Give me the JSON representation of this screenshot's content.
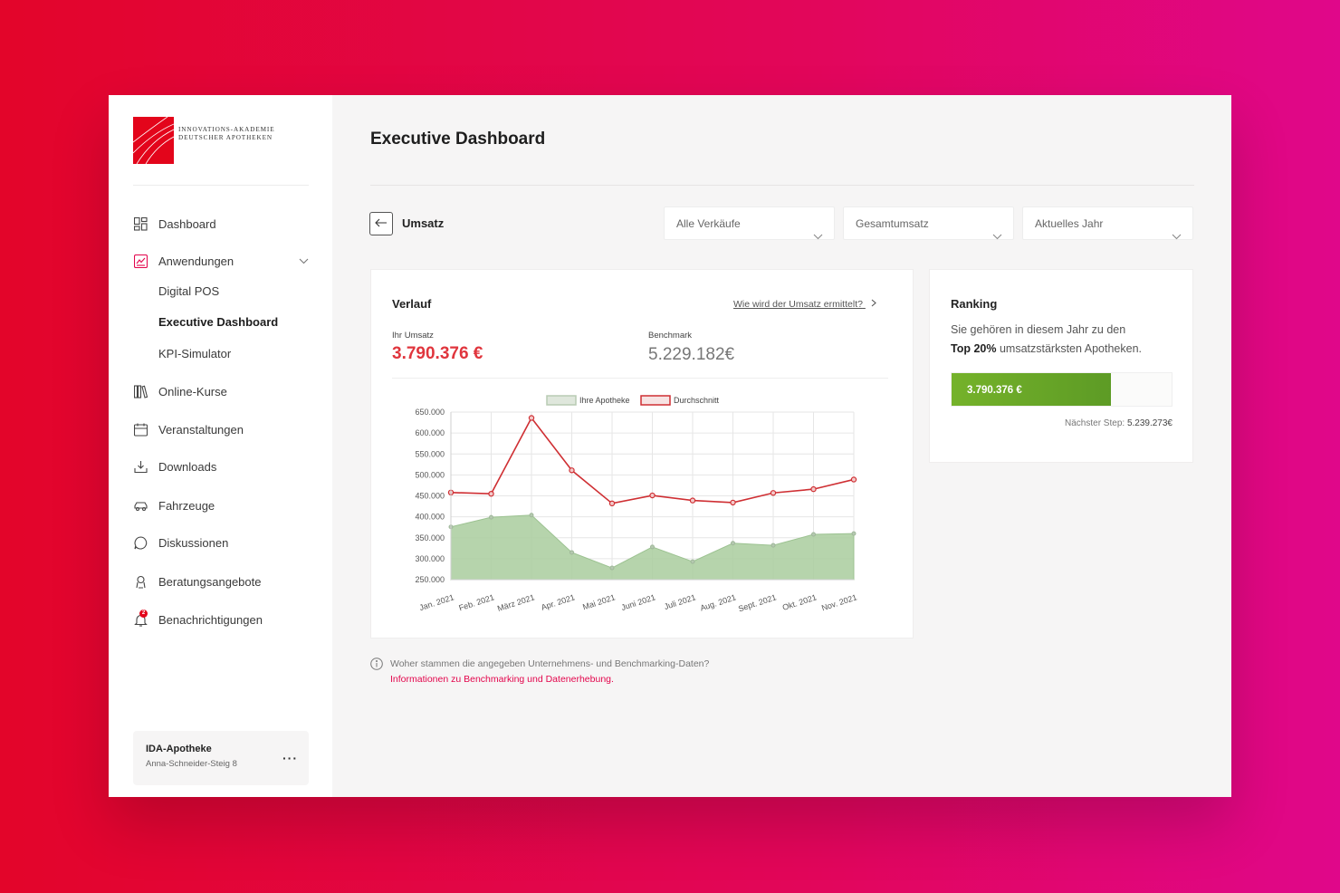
{
  "logo": {
    "line1": "INNOVATIONS-AKADEMIE",
    "line2": "DEUTSCHER APOTHEKEN"
  },
  "sidebar": {
    "items": [
      {
        "label": "Dashboard",
        "icon": "dashboard-icon"
      },
      {
        "label": "Anwendungen",
        "icon": "chart-app-icon"
      },
      {
        "label": "Online-Kurse",
        "icon": "books-icon"
      },
      {
        "label": "Veranstaltungen",
        "icon": "calendar-icon"
      },
      {
        "label": "Downloads",
        "icon": "download-icon"
      },
      {
        "label": "Fahrzeuge",
        "icon": "car-icon"
      },
      {
        "label": "Diskussionen",
        "icon": "chat-icon"
      },
      {
        "label": "Beratungsangebote",
        "icon": "consulting-icon"
      },
      {
        "label": "Benachrichtigungen",
        "icon": "bell-icon"
      }
    ],
    "subitems": [
      {
        "label": "Digital POS"
      },
      {
        "label": "Executive Dashboard"
      },
      {
        "label": "KPI-Simulator"
      }
    ],
    "notification_count": "2",
    "account": {
      "name": "IDA-Apotheke",
      "address": "Anna-Schneider-Steig 8",
      "more": "···"
    }
  },
  "header": {
    "title": "Executive Dashboard"
  },
  "toolbar": {
    "section": "Umsatz",
    "filters": [
      "Alle Verkäufe",
      "Gesamtumsatz",
      "Aktuelles Jahr"
    ]
  },
  "verlauf": {
    "title": "Verlauf",
    "help_link": "Wie wird der Umsatz ermittelt?",
    "kpi_label": "Ihr Umsatz",
    "kpi_value": "3.790.376 €",
    "benchmark_label": "Benchmark",
    "benchmark_value": "5.229.182€"
  },
  "ranking": {
    "title": "Ranking",
    "text_pre": "Sie gehören in diesem Jahr zu den",
    "text_bold": "Top 20%",
    "text_post": " umsatzstärksten Apotheken.",
    "bar_label": "3.790.376 €",
    "bar_fraction": 0.725,
    "next_label": "Nächster Step: ",
    "next_value": "5.239.273€"
  },
  "info": {
    "question": "Woher stammen die angegeben Unternehmens- und Benchmarking-Daten?",
    "link": "Informationen zu Benchmarking und Datenerhebung."
  },
  "colors": {
    "accent_red": "#e3051b",
    "series_green": "#a9cc9e",
    "series_red": "#cf2f33"
  },
  "chart_data": {
    "type": "line",
    "categories": [
      "Jan. 2021",
      "Feb. 2021",
      "März 2021",
      "Apr. 2021",
      "Mai 2021",
      "Juni 2021",
      "Juli 2021",
      "Aug. 2021",
      "Sept. 2021",
      "Okt. 2021",
      "Nov. 2021"
    ],
    "series": [
      {
        "name": "Ihre Apotheke",
        "style": "area",
        "values": [
          376000,
          399000,
          404000,
          315000,
          278000,
          328000,
          293000,
          337000,
          332000,
          358000,
          360000
        ]
      },
      {
        "name": "Durchschnitt",
        "style": "line",
        "values": [
          458000,
          455000,
          636000,
          511000,
          432000,
          451000,
          439000,
          434000,
          457000,
          466000,
          489000
        ]
      }
    ],
    "yticks": [
      "650.000",
      "600.000",
      "550.000",
      "500.000",
      "450.000",
      "400.000",
      "350.000",
      "300.000",
      "250.000"
    ],
    "ylim": [
      250000,
      650000
    ],
    "grid": true,
    "legend": "top-center"
  }
}
